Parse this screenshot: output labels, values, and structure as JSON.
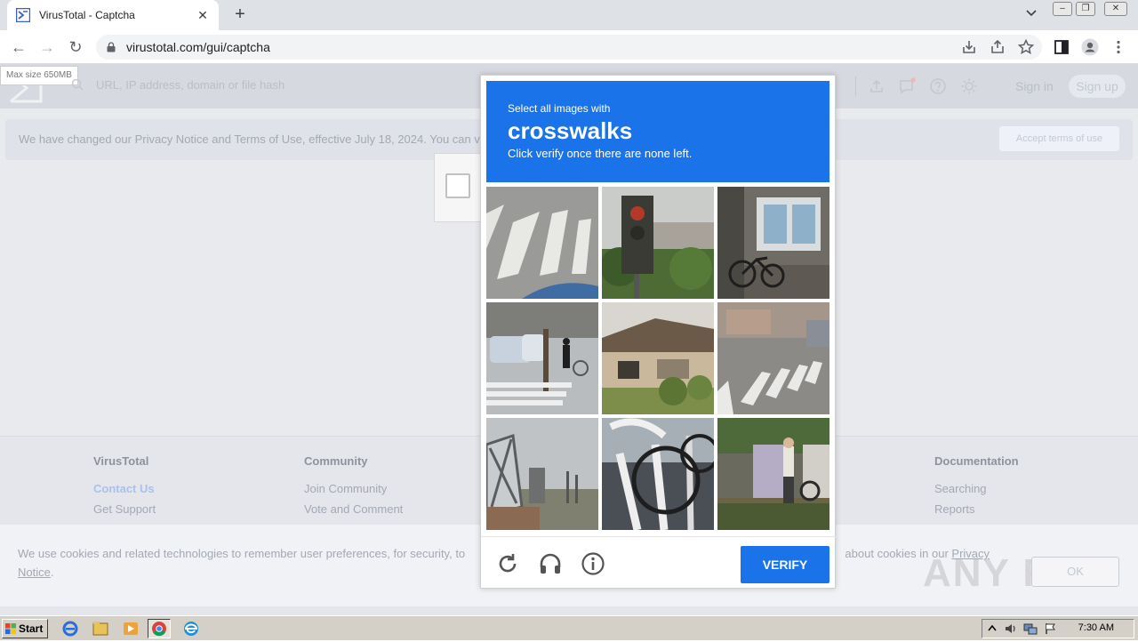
{
  "browser": {
    "tab_title": "VirusTotal - Captcha",
    "tab_close": "✕",
    "new_tab": "+",
    "url": "virustotal.com/gui/captcha",
    "back": "←",
    "forward": "→",
    "reload": "↻"
  },
  "virustotal": {
    "max_size": "Max size 650MB",
    "search_placeholder": "URL, IP address, domain or file hash",
    "sign_in": "Sign in",
    "sign_up": "Sign up",
    "notice_text": "We have changed our Privacy Notice and Terms of Use, effective July 18, 2024. You can v",
    "accept_terms": "Accept terms of use",
    "footer": {
      "col1_title": "VirusTotal",
      "col1_links": [
        "Contact Us",
        "Get Support"
      ],
      "col2_title": "Community",
      "col2_links": [
        "Join Community",
        "Vote and Comment"
      ],
      "col3_title": "Documentation",
      "col3_links": [
        "Searching",
        "Reports"
      ]
    },
    "cookie_text_a": "We use cookies and related technologies to remember user preferences, for security, to",
    "cookie_text_b": "about cookies in our",
    "cookie_link_a": "Privacy",
    "cookie_link_b": "Notice",
    "cookie_end": ".",
    "ok": "OK",
    "watermark": "ANY RUN"
  },
  "captcha": {
    "instruction": "Select all images with",
    "target": "crosswalks",
    "subtext": "Click verify once there are none left.",
    "verify_label": "VERIFY",
    "tiles": [
      "crosswalk-stripes",
      "traffic-light",
      "bicycle-indoors",
      "street-crosswalk-cars",
      "houses",
      "road-crosswalk",
      "bridge-structure",
      "metal-railing",
      "person-bicycle"
    ]
  },
  "taskbar": {
    "start": "Start",
    "clock": "7:30 AM"
  }
}
